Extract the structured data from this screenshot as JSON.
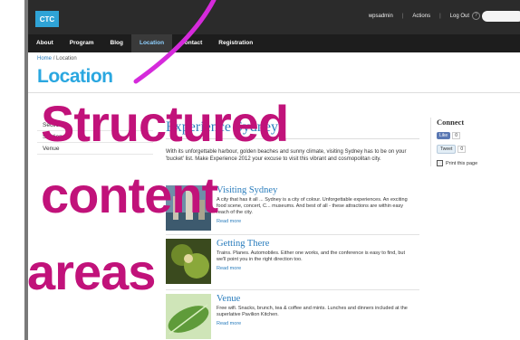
{
  "topbar": {
    "logo": "CTC",
    "admin_links": [
      "wpsadmin",
      "Actions",
      "Log Out"
    ]
  },
  "nav": [
    "About",
    "Program",
    "Blog",
    "Location",
    "Contact",
    "Registration"
  ],
  "nav_active": "Location",
  "breadcrumb": {
    "home": "Home",
    "sep": "/",
    "current": "Location"
  },
  "page_title": "Location",
  "sidenav": [
    "Section 1",
    "Section 2",
    "Venue"
  ],
  "main": {
    "heading": "Experience Sydney",
    "intro": "With its unforgettable harbour, golden beaches and sunny climate, visiting Sydney has to be on your 'bucket' list. Make Experience 2012 your excuse to visit this vibrant and cosmopolitan city."
  },
  "cards": [
    {
      "title": "Visiting Sydney",
      "text": "A city that has it all ... Sydney is a city of colour. Unforgettable experiences. An exciting food scene, concert, C... museums. And best of all - these attractions are within easy reach of the city.",
      "more": "Read more"
    },
    {
      "title": "Getting There",
      "text": "Trains. Planes. Automobiles. Either one works, and the conference is easy to find, but we'll point you in the right direction too.",
      "more": "Read more"
    },
    {
      "title": "Venue",
      "text": "Free wifi. Snacks, brunch, tea & coffee and mints. Lunches and dinners included at the superlative Pavilion Kitchen.",
      "more": "Read more"
    }
  ],
  "connect": {
    "title": "Connect",
    "like_label": "Like",
    "like_count": "0",
    "tweet_label": "Tweet",
    "tweet_count": "0",
    "print_label": "Print this page"
  },
  "annotation": {
    "words": [
      "Structured",
      "content",
      "areas"
    ],
    "color": "#c1127a"
  }
}
